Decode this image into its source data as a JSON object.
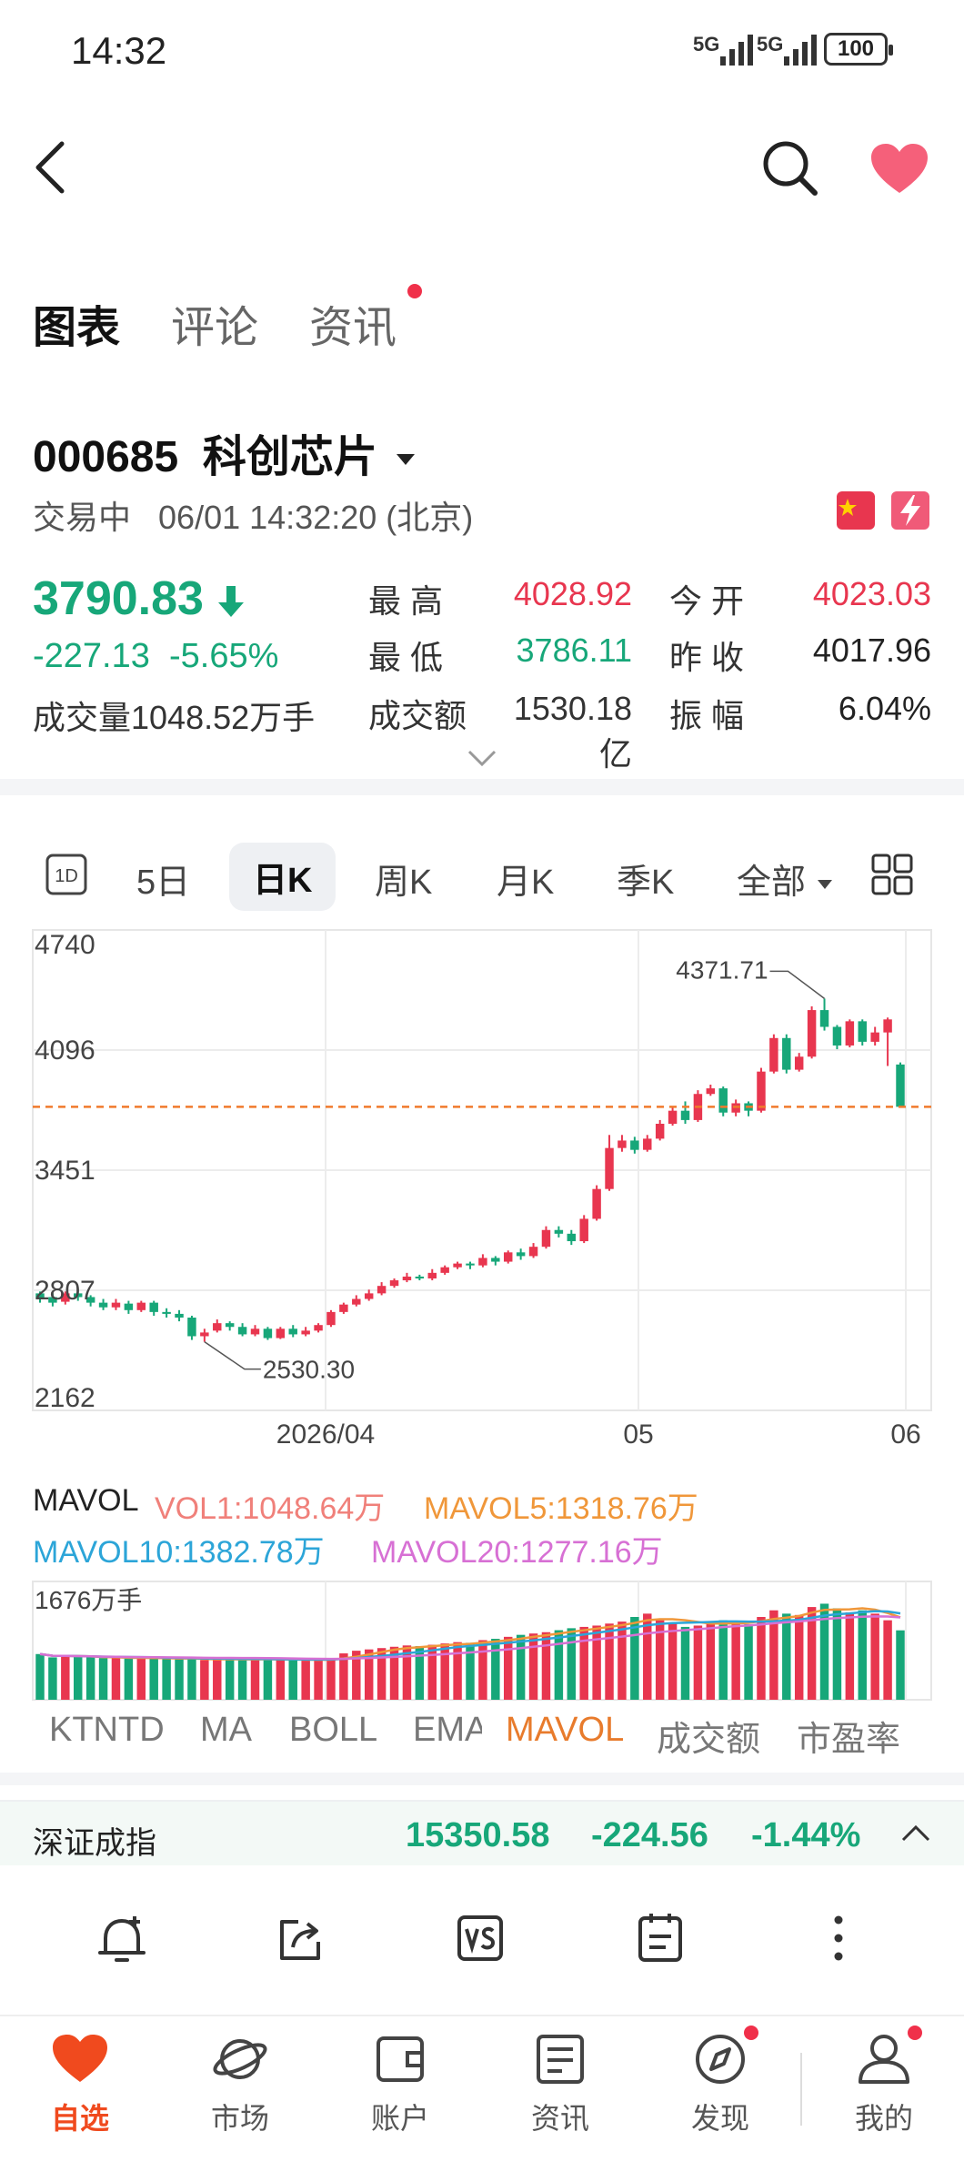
{
  "status_bar": {
    "time": "14:32",
    "signal1": "5G",
    "signal2": "5G",
    "battery": "100"
  },
  "tabs": [
    {
      "label": "图表"
    },
    {
      "label": "评论"
    },
    {
      "label": "资讯"
    }
  ],
  "stock": {
    "code": "000685",
    "name": "科创芯片",
    "trade_status": "交易中",
    "datetime": "06/01 14:32:20 (北京)",
    "price": "3790.83",
    "change": "-227.13",
    "change_pct": "-5.65%",
    "volume_label": "成交量",
    "volume": "1048.52万手",
    "amount_label": "成交额",
    "amount": "1530.18亿",
    "high_label": "最 高",
    "high": "4028.92",
    "low_label": "最 低",
    "low": "3786.11",
    "open_label": "今 开",
    "open": "4023.03",
    "prev_close_label": "昨 收",
    "prev_close": "4017.96",
    "amplitude_label": "振 幅",
    "amplitude": "6.04%"
  },
  "periods": [
    {
      "label": "1D"
    },
    {
      "label": "5日"
    },
    {
      "label": "日K"
    },
    {
      "label": "周K"
    },
    {
      "label": "月K"
    },
    {
      "label": "季K"
    },
    {
      "label": "全部"
    }
  ],
  "chart_data": {
    "type": "candlestick",
    "y_ticks": [
      "4740",
      "4096",
      "3451",
      "2807",
      "2162"
    ],
    "ylim": [
      2162,
      4740
    ],
    "x_ticks": [
      "2026/04",
      "05",
      "06"
    ],
    "high_annotation": "4371.71",
    "low_annotation": "2530.30",
    "current_price_line": 3790.83,
    "candles": [
      [
        2790,
        2760,
        2800,
        2740
      ],
      [
        2770,
        2740,
        2790,
        2720
      ],
      [
        2745,
        2790,
        2800,
        2730
      ],
      [
        2790,
        2770,
        2810,
        2750
      ],
      [
        2770,
        2740,
        2780,
        2720
      ],
      [
        2740,
        2715,
        2760,
        2700
      ],
      [
        2715,
        2740,
        2760,
        2700
      ],
      [
        2735,
        2700,
        2750,
        2680
      ],
      [
        2700,
        2740,
        2750,
        2690
      ],
      [
        2740,
        2690,
        2750,
        2670
      ],
      [
        2690,
        2680,
        2710,
        2660
      ],
      [
        2680,
        2660,
        2700,
        2640
      ],
      [
        2660,
        2560,
        2670,
        2540
      ],
      [
        2560,
        2580,
        2600,
        2530
      ],
      [
        2590,
        2630,
        2650,
        2580
      ],
      [
        2630,
        2610,
        2640,
        2590
      ],
      [
        2610,
        2570,
        2630,
        2560
      ],
      [
        2570,
        2600,
        2620,
        2560
      ],
      [
        2600,
        2550,
        2610,
        2540
      ],
      [
        2550,
        2600,
        2610,
        2545
      ],
      [
        2600,
        2570,
        2620,
        2555
      ],
      [
        2570,
        2590,
        2610,
        2560
      ],
      [
        2590,
        2620,
        2630,
        2580
      ],
      [
        2620,
        2690,
        2700,
        2610
      ],
      [
        2690,
        2730,
        2740,
        2680
      ],
      [
        2730,
        2760,
        2780,
        2720
      ],
      [
        2760,
        2790,
        2810,
        2750
      ],
      [
        2790,
        2830,
        2850,
        2780
      ],
      [
        2830,
        2860,
        2870,
        2820
      ],
      [
        2860,
        2880,
        2900,
        2850
      ],
      [
        2880,
        2870,
        2890,
        2860
      ],
      [
        2870,
        2900,
        2920,
        2860
      ],
      [
        2900,
        2930,
        2940,
        2890
      ],
      [
        2930,
        2950,
        2960,
        2920
      ],
      [
        2950,
        2940,
        2960,
        2920
      ],
      [
        2940,
        2980,
        3000,
        2930
      ],
      [
        2980,
        2960,
        2990,
        2940
      ],
      [
        2960,
        3010,
        3020,
        2950
      ],
      [
        3010,
        2990,
        3030,
        2970
      ],
      [
        2990,
        3040,
        3060,
        2980
      ],
      [
        3040,
        3130,
        3150,
        3030
      ],
      [
        3130,
        3110,
        3150,
        3090
      ],
      [
        3110,
        3070,
        3130,
        3050
      ],
      [
        3070,
        3190,
        3210,
        3060
      ],
      [
        3190,
        3350,
        3370,
        3180
      ],
      [
        3350,
        3570,
        3640,
        3340
      ],
      [
        3570,
        3610,
        3640,
        3550
      ],
      [
        3610,
        3560,
        3630,
        3540
      ],
      [
        3560,
        3620,
        3640,
        3550
      ],
      [
        3620,
        3700,
        3720,
        3610
      ],
      [
        3700,
        3770,
        3790,
        3690
      ],
      [
        3770,
        3720,
        3820,
        3700
      ],
      [
        3720,
        3860,
        3880,
        3710
      ],
      [
        3860,
        3890,
        3910,
        3850
      ],
      [
        3890,
        3760,
        3900,
        3740
      ],
      [
        3760,
        3810,
        3830,
        3740
      ],
      [
        3810,
        3770,
        3820,
        3740
      ],
      [
        3770,
        3980,
        4000,
        3760
      ],
      [
        3980,
        4160,
        4180,
        3970
      ],
      [
        4160,
        3990,
        4180,
        3970
      ],
      [
        3990,
        4060,
        4080,
        3980
      ],
      [
        4060,
        4310,
        4330,
        4050
      ],
      [
        4310,
        4220,
        4372,
        4200
      ],
      [
        4220,
        4120,
        4230,
        4100
      ],
      [
        4120,
        4250,
        4260,
        4110
      ],
      [
        4250,
        4140,
        4260,
        4120
      ],
      [
        4140,
        4190,
        4220,
        4120
      ],
      [
        4190,
        4260,
        4270,
        4010
      ],
      [
        4018,
        3791,
        4029,
        3786
      ]
    ],
    "volume": {
      "label": "MAVOL",
      "vol1": "VOL1:1048.64万",
      "mavol5": "MAVOL5:1318.76万",
      "mavol10": "MAVOL10:1382.78万",
      "mavol20": "MAVOL20:1277.16万",
      "max_label": "1676万手",
      "max": 1676,
      "values": [
        690,
        640,
        660,
        650,
        640,
        630,
        630,
        620,
        640,
        630,
        620,
        610,
        620,
        600,
        610,
        620,
        600,
        620,
        610,
        600,
        610,
        590,
        600,
        620,
        700,
        740,
        760,
        780,
        800,
        820,
        810,
        830,
        850,
        870,
        860,
        900,
        920,
        950,
        980,
        1000,
        1020,
        1050,
        1080,
        1100,
        1120,
        1150,
        1180,
        1250,
        1300,
        1200,
        1150,
        1100,
        1120,
        1180,
        1200,
        1160,
        1140,
        1250,
        1350,
        1300,
        1280,
        1400,
        1450,
        1380,
        1320,
        1350,
        1300,
        1200,
        1048
      ]
    }
  },
  "indicators": [
    {
      "label": "KTNTD"
    },
    {
      "label": "MA"
    },
    {
      "label": "BOLL"
    },
    {
      "label": "EMA"
    },
    {
      "label": "MAVOL"
    },
    {
      "label": "成交额"
    },
    {
      "label": "市盈率"
    }
  ],
  "index_bar": {
    "name": "深证成指",
    "value": "15350.58",
    "change": "-224.56",
    "change_pct": "-1.44%"
  },
  "bottom_nav": [
    {
      "label": "自选"
    },
    {
      "label": "市场"
    },
    {
      "label": "账户"
    },
    {
      "label": "资讯"
    },
    {
      "label": "发现"
    },
    {
      "label": "我的"
    }
  ]
}
